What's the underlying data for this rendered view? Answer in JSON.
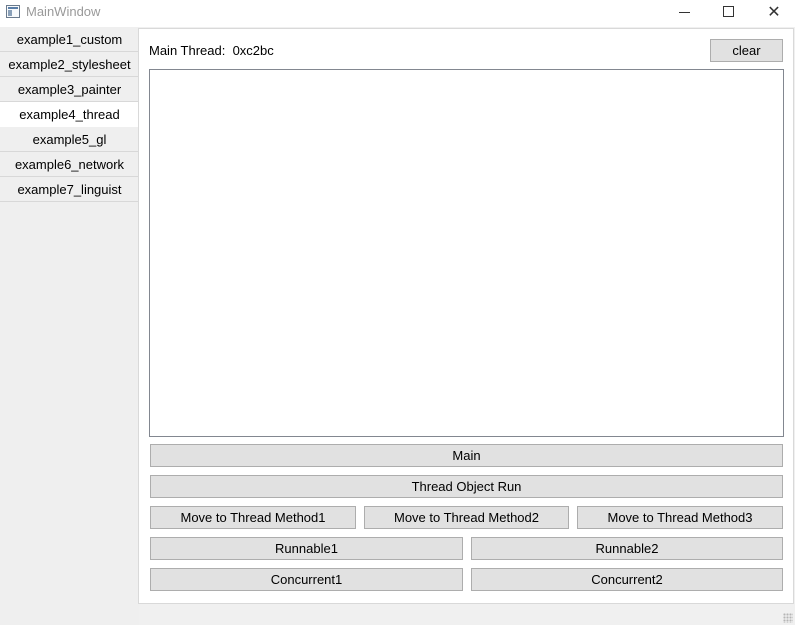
{
  "window": {
    "title": "MainWindow",
    "icons": {
      "app": "window-app-icon",
      "minimize": "minimize-icon",
      "maximize": "maximize-icon",
      "close": "close-icon"
    },
    "close_glyph": "✕"
  },
  "sidebar": {
    "items": [
      {
        "label": "example1_custom",
        "active": false
      },
      {
        "label": "example2_stylesheet",
        "active": false
      },
      {
        "label": "example3_painter",
        "active": false
      },
      {
        "label": "example4_thread",
        "active": true
      },
      {
        "label": "example5_gl",
        "active": false
      },
      {
        "label": "example6_network",
        "active": false
      },
      {
        "label": "example7_linguist",
        "active": false
      }
    ]
  },
  "main": {
    "thread_label": "Main Thread:  0xc2bc",
    "clear_label": "clear",
    "output_text": "",
    "buttons": {
      "main": "Main",
      "thread_object_run": "Thread Object Run",
      "move1": "Move to Thread Method1",
      "move2": "Move to Thread Method2",
      "move3": "Move to Thread Method3",
      "runnable1": "Runnable1",
      "runnable2": "Runnable2",
      "concurrent1": "Concurrent1",
      "concurrent2": "Concurrent2"
    }
  },
  "colors": {
    "button_bg": "#e1e1e1",
    "button_border": "#adadad",
    "sidebar_bg": "#efefef",
    "active_tab_bg": "#ffffff"
  }
}
